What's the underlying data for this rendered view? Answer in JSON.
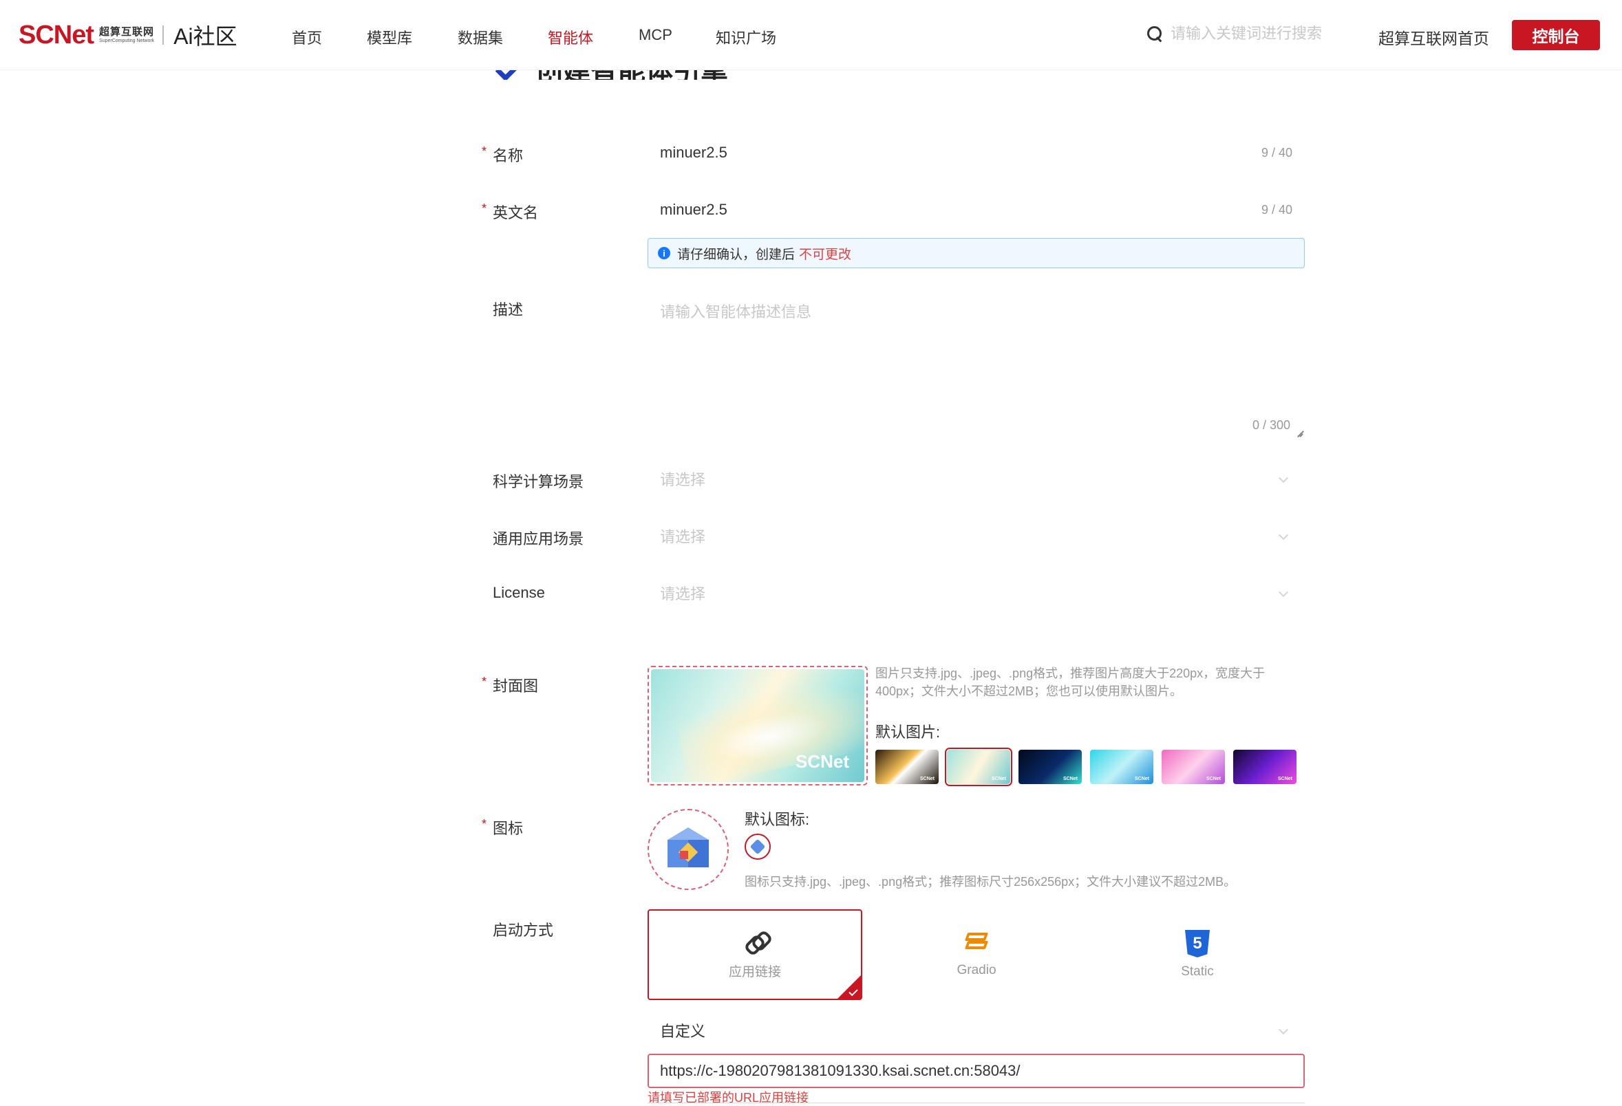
{
  "header": {
    "logo_brand_sc": "SC",
    "logo_brand_net": "Net",
    "logo_sub_cn": "超算互联网",
    "logo_sub_en": "SuperComputing Network",
    "logo_community": "Ai社区",
    "nav": [
      {
        "label": "首页",
        "active": false
      },
      {
        "label": "模型库",
        "active": false
      },
      {
        "label": "数据集",
        "active": false
      },
      {
        "label": "智能体",
        "active": true
      },
      {
        "label": "MCP",
        "active": false
      },
      {
        "label": "知识广场",
        "active": false
      }
    ],
    "search_placeholder": "请输入关键词进行搜索",
    "home_link": "超算互联网首页",
    "console_button": "控制台"
  },
  "page_title": "创建智能体引擎",
  "form": {
    "name": {
      "label": "名称",
      "value": "minuer2.5",
      "counter": "9 / 40"
    },
    "english_name": {
      "label": "英文名",
      "value": "minuer2.5",
      "counter": "9 / 40"
    },
    "hint": {
      "text": "请仔细确认，创建后",
      "warn": "不可更改"
    },
    "description": {
      "label": "描述",
      "placeholder": "请输入智能体描述信息",
      "counter": "0 / 300"
    },
    "science_scene": {
      "label": "科学计算场景",
      "placeholder": "请选择"
    },
    "general_scene": {
      "label": "通用应用场景",
      "placeholder": "请选择"
    },
    "license": {
      "label": "License",
      "placeholder": "请选择"
    },
    "cover": {
      "label": "封面图",
      "brand": "SCNet",
      "desc": "图片只支持.jpg、.jpeg、.png格式，推荐图片高度大于220px，宽度大于400px；文件大小不超过2MB；您也可以使用默认图片。",
      "default_label": "默认图片:",
      "thumb_brand": "SCNet",
      "thumbs": [
        {
          "bg": "linear-gradient(135deg,#2b1a0a 0%,#f7c35a 45%,#fff 52%,#1b1208 100%)",
          "selected": false
        },
        {
          "bg": "linear-gradient(120deg,#9fe3dd 0%,#fff6dc 50%,#6fcad0 100%)",
          "selected": true
        },
        {
          "bg": "linear-gradient(135deg,#020a1c 0%,#0a2a6a 55%,#35e0d0 100%)",
          "selected": false
        },
        {
          "bg": "linear-gradient(135deg,#2fd6e8 0%,#bff2f7 50%,#1c8fdc 100%)",
          "selected": false
        },
        {
          "bg": "linear-gradient(135deg,#f06ac0 0%,#ffd1ec 50%,#b24bd9 100%)",
          "selected": false
        },
        {
          "bg": "linear-gradient(135deg,#12062e 0%,#6a1fd0 50%,#f04be0 100%)",
          "selected": false
        }
      ]
    },
    "icon": {
      "label": "图标",
      "default_label": "默认图标:",
      "desc": "图标只支持.jpg、.jpeg、.png格式；推荐图标尺寸256x256px；文件大小建议不超过2MB。"
    },
    "launch": {
      "label": "启动方式",
      "options": [
        {
          "label": "应用链接",
          "icon": "link-icon",
          "selected": true
        },
        {
          "label": "Gradio",
          "icon": "gradio-icon",
          "selected": false
        },
        {
          "label": "Static",
          "icon": "html5-icon",
          "selected": false
        }
      ],
      "mode": "自定义",
      "url_value": "https://c-1980207981381091330.ksai.scnet.cn:58043/",
      "url_error": "请填写已部署的URL应用链接"
    }
  },
  "colors": {
    "brand_red": "#c81623",
    "hint_border": "#91caff"
  }
}
